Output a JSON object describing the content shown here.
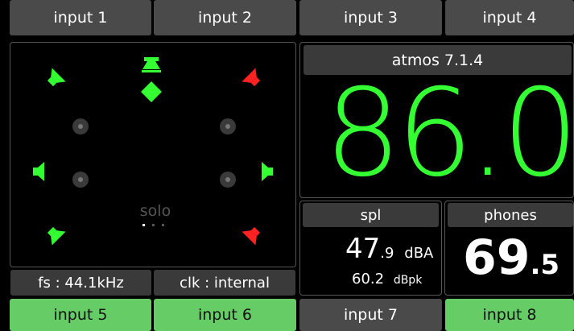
{
  "inputs_top": [
    "input 1",
    "input 2",
    "input 3",
    "input 4"
  ],
  "inputs_bottom": [
    "input 5",
    "input 6",
    "input 7",
    "input 8"
  ],
  "format": "atmos 7.1.4",
  "level": {
    "int": "86",
    "dec": ".0"
  },
  "spl": {
    "label": "spl",
    "value_int": "47",
    "value_dec": ".9",
    "unit": "dBA",
    "peak": "60.2",
    "peak_unit": "dBpk"
  },
  "phones": {
    "label": "phones",
    "value_int": "69",
    "value_dec": ".5"
  },
  "speaker_panel": {
    "solo_label": "solo"
  },
  "status": {
    "fs": "fs : 44.1kHz",
    "clk": "clk : internal"
  },
  "colors": {
    "active": "#33ff33",
    "muted": "#ff2222",
    "inactive": "#666666"
  }
}
